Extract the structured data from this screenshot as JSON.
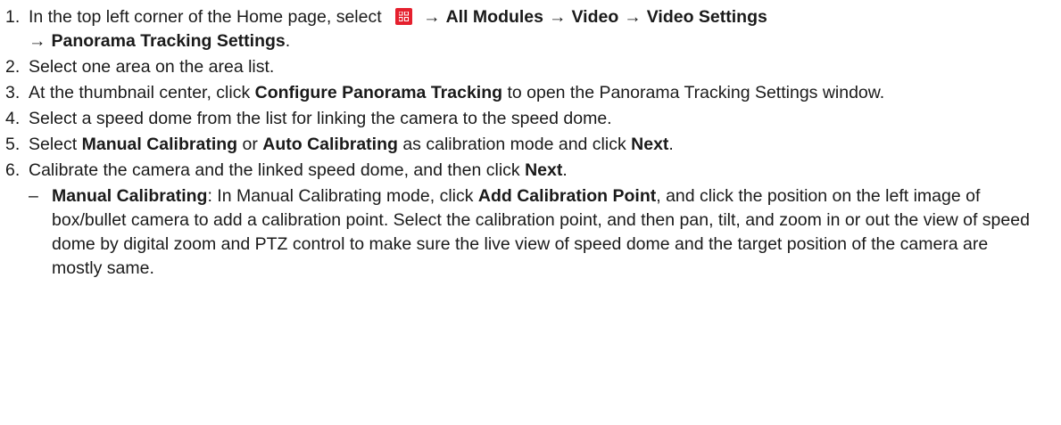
{
  "steps": [
    {
      "num": "1.",
      "intro": "In the top left corner of the Home page, select",
      "menu_icon": "grid-menu-icon",
      "arrow": "→",
      "path": [
        "All Modules",
        "Video",
        "Video Settings",
        "Panorama Tracking Settings"
      ],
      "end": "."
    },
    {
      "num": "2.",
      "text": "Select one area on the area list."
    },
    {
      "num": "3.",
      "pre": "At the thumbnail center, click ",
      "bold": "Configure Panorama Tracking",
      "post": " to open the Panorama Tracking Settings window."
    },
    {
      "num": "4.",
      "text": "Select a speed dome from the list for linking the camera to the speed dome."
    },
    {
      "num": "5.",
      "pre": "Select ",
      "bold1": "Manual Calibrating",
      "mid": " or ",
      "bold2": "Auto Calibrating",
      "mid2": " as calibration mode and click ",
      "bold3": "Next",
      "end": "."
    },
    {
      "num": "6.",
      "pre": "Calibrate the camera and the linked speed dome, and then click ",
      "bold": "Next",
      "end": ".",
      "sub": {
        "dash": "–",
        "bold1": "Manual Calibrating",
        "text1": ": In Manual Calibrating mode, click ",
        "bold2": "Add Calibration Point",
        "text2": ", and click the position on the left image of box/bullet camera to add a calibration point. Select the calibration point, and then pan, tilt, and zoom in or out the view of speed dome by digital zoom and PTZ control to make sure the live view of speed dome and the target position of the camera are mostly same."
      }
    }
  ],
  "colors": {
    "icon_red": "#e5202e",
    "text": "#1a1a1a"
  }
}
